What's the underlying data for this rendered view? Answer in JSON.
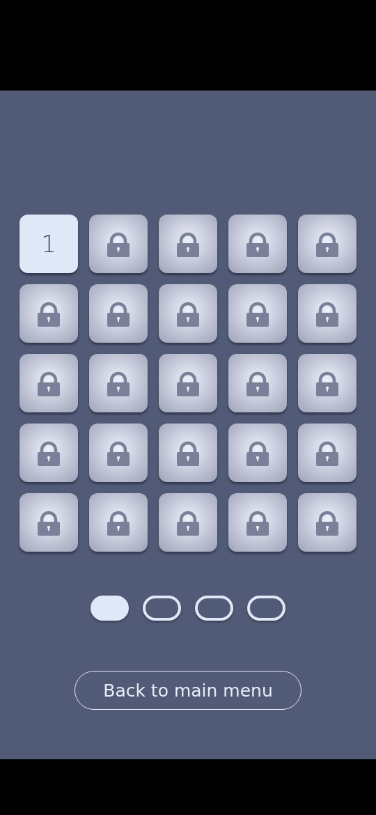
{
  "levels": [
    {
      "label": "1",
      "locked": false
    },
    {
      "locked": true
    },
    {
      "locked": true
    },
    {
      "locked": true
    },
    {
      "locked": true
    },
    {
      "locked": true
    },
    {
      "locked": true
    },
    {
      "locked": true
    },
    {
      "locked": true
    },
    {
      "locked": true
    },
    {
      "locked": true
    },
    {
      "locked": true
    },
    {
      "locked": true
    },
    {
      "locked": true
    },
    {
      "locked": true
    },
    {
      "locked": true
    },
    {
      "locked": true
    },
    {
      "locked": true
    },
    {
      "locked": true
    },
    {
      "locked": true
    },
    {
      "locked": true
    },
    {
      "locked": true
    },
    {
      "locked": true
    },
    {
      "locked": true
    },
    {
      "locked": true
    }
  ],
  "pages": [
    {
      "selected": true
    },
    {
      "selected": false
    },
    {
      "selected": false
    },
    {
      "selected": false
    }
  ],
  "back_button": "Back to main menu"
}
